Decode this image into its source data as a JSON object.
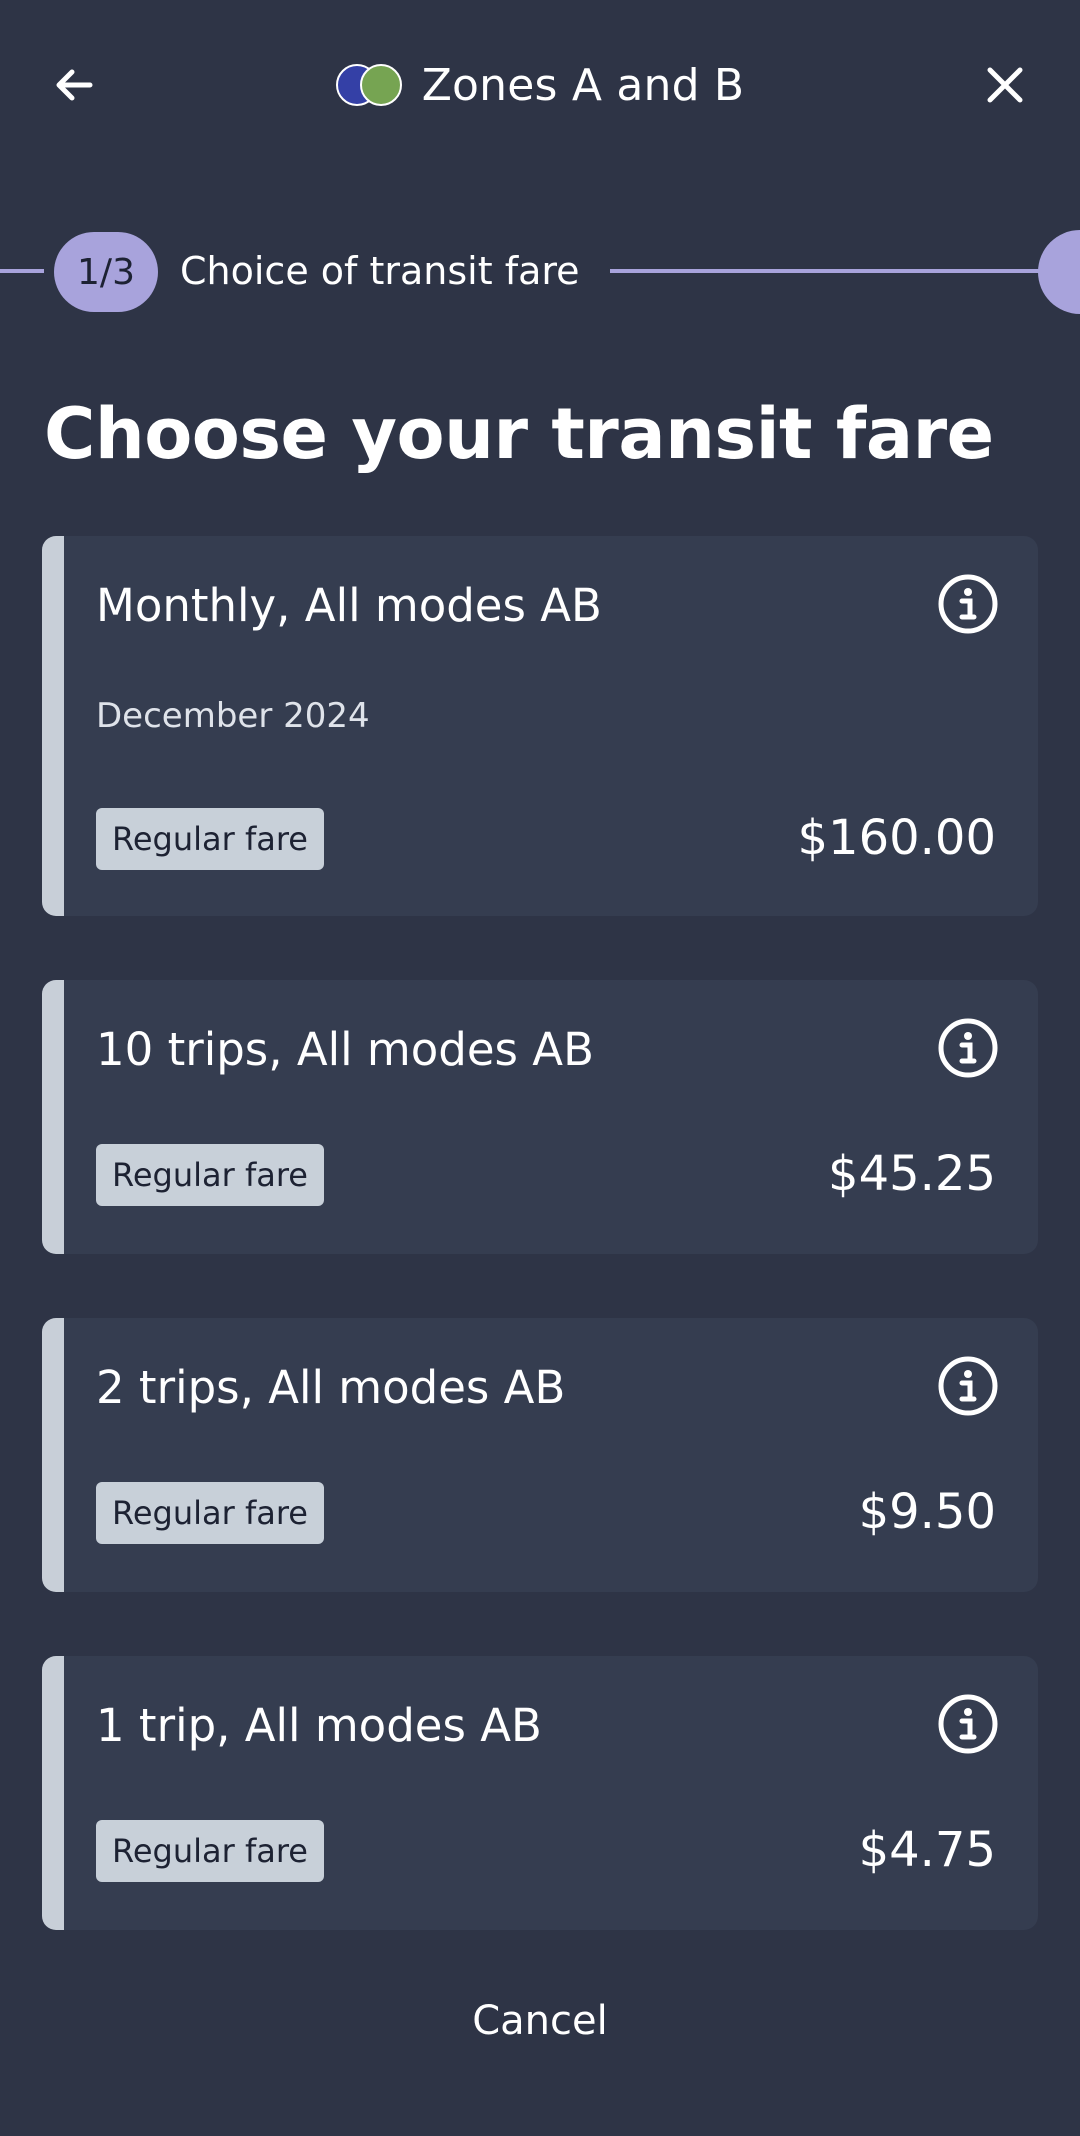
{
  "header": {
    "title": "Zones A and B",
    "back_icon": "arrow-left-icon",
    "close_icon": "close-icon",
    "zone_colors": [
      "#3440a6",
      "#76a452"
    ]
  },
  "progress": {
    "step": "1/3",
    "label": "Choice of transit fare"
  },
  "page_title": "Choose your transit fare",
  "fares": [
    {
      "title": "Monthly, All modes AB",
      "subtitle": "December 2024",
      "badge": "Regular fare",
      "price": "$160.00"
    },
    {
      "title": "10 trips, All modes AB",
      "badge": "Regular fare",
      "price": "$45.25"
    },
    {
      "title": "2 trips, All modes AB",
      "badge": "Regular fare",
      "price": "$9.50"
    },
    {
      "title": "1 trip, All modes AB",
      "badge": "Regular fare",
      "price": "$4.75"
    }
  ],
  "cancel_label": "Cancel",
  "colors": {
    "background": "#2e3446",
    "card": "#353d50",
    "accent": "#a8a3dc",
    "badge": "#c8d0d9"
  }
}
